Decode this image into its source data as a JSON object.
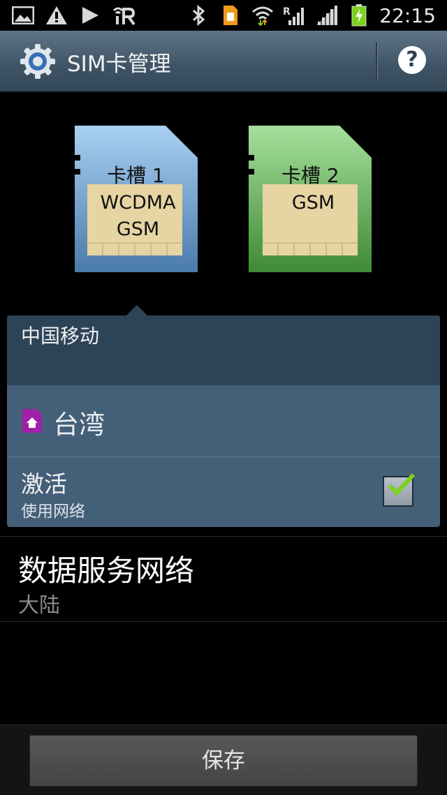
{
  "statusbar": {
    "time": "22:15",
    "left_icons": [
      "gallery-icon",
      "warning-icon",
      "play-icon",
      "ar-icon"
    ],
    "right_icons": [
      "bluetooth-icon",
      "sim-notify-icon",
      "wifi-icon",
      "signal-roaming-icon",
      "signal-icon",
      "battery-charging-icon"
    ],
    "roaming_label": "R"
  },
  "actionbar": {
    "title": "SIM卡管理",
    "help_glyph": "?"
  },
  "sim_slots": [
    {
      "label": "卡槽 1",
      "types": [
        "WCDMA",
        "GSM"
      ],
      "color": "#5f93c8"
    },
    {
      "label": "卡槽 2",
      "types": [
        "GSM"
      ],
      "color": "#4f9b45"
    }
  ],
  "panel": {
    "carrier": "中国移动",
    "network_name": "台湾",
    "activate_title": "激活",
    "activate_subtitle": "使用网络",
    "activate_checked": true
  },
  "data_service": {
    "title": "数据服务网络",
    "value": "大陆"
  },
  "buttons": {
    "save": "保存"
  },
  "colors": {
    "actionbar": "#3e5466",
    "panel": "#445f78",
    "panel_header": "#2d4358",
    "check": "#7bd21a",
    "network_icon": "#a020a8"
  }
}
